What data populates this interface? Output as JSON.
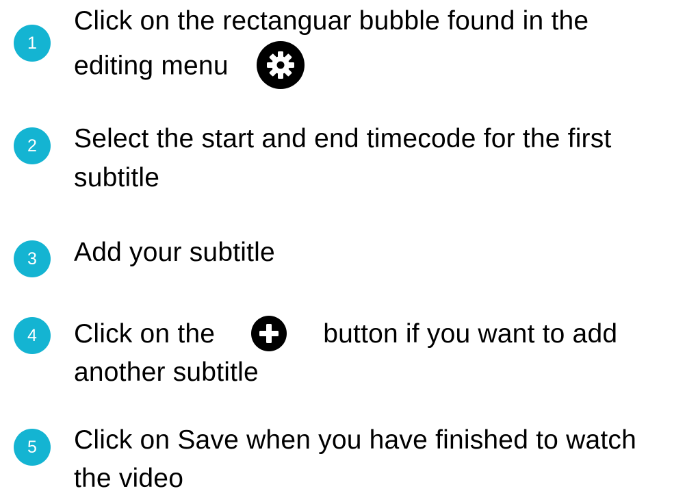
{
  "accent_color": "#14b4d2",
  "steps": [
    {
      "number": "1",
      "line1": "Click on the rectanguar bubble found in the",
      "line2": "editing menu",
      "icon": "gear-icon"
    },
    {
      "number": "2",
      "line1": "Select the start and end timecode for the first",
      "line2": "subtitle"
    },
    {
      "number": "3",
      "line1": "Add your subtitle"
    },
    {
      "number": "4",
      "line1_before": "Click on the",
      "line1_after": "button if you want to add",
      "line2": "another subtitle",
      "icon": "plus-icon"
    },
    {
      "number": "5",
      "line1": "Click on Save when you have finished to watch",
      "line2": "the video"
    }
  ]
}
